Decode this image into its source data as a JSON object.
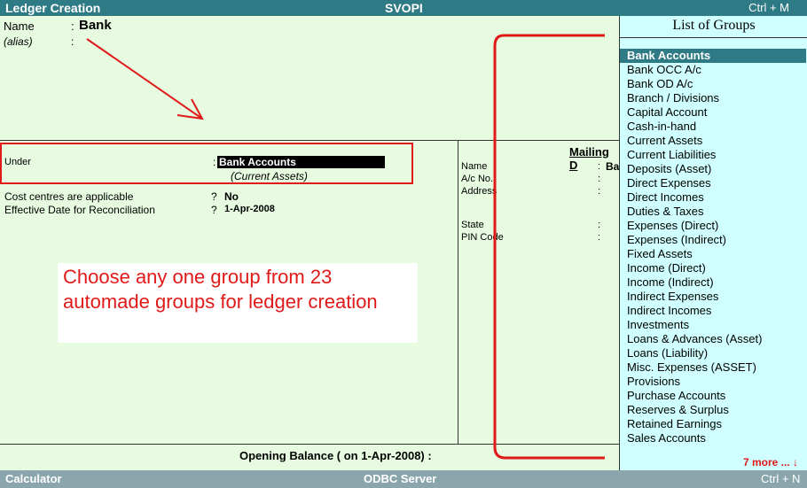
{
  "title_bar": {
    "left": "Ledger Creation",
    "center": "SVOPI",
    "shortcut": "Ctrl + M"
  },
  "form": {
    "name_label": "Name",
    "colon": ":",
    "name_value": "Bank",
    "alias_label": "(alias)",
    "under_label": "Under",
    "under_value": "Bank Accounts",
    "under_sub": "(Current Assets)",
    "cost_centres_label": "Cost centres are applicable",
    "cost_centres_q": "?",
    "cost_centres_value": "No",
    "effective_date_label": "Effective Date for Reconciliation",
    "effective_date_q": "?",
    "effective_date_value": "1-Apr-2008"
  },
  "annotation": {
    "text": "Choose any one group from 23 automade groups for ledger creation"
  },
  "mailing": {
    "title": "Mailing D",
    "fields": [
      "Name",
      "A/c No.",
      "Address",
      "State",
      "PIN Code"
    ],
    "name_value": "Ba"
  },
  "opening_balance": "Opening Balance  ( on 1-Apr-2008) :",
  "status_bar": {
    "left": "Calculator",
    "center": "ODBC Server",
    "shortcut": "Ctrl + N"
  },
  "list_of_groups": {
    "title": "List of Groups",
    "items": [
      "Bank Accounts",
      "Bank OCC A/c",
      "Bank OD A/c",
      "Branch / Divisions",
      "Capital Account",
      "Cash-in-hand",
      "Current Assets",
      "Current Liabilities",
      "Deposits (Asset)",
      "Direct Expenses",
      "Direct Incomes",
      "Duties & Taxes",
      "Expenses (Direct)",
      "Expenses (Indirect)",
      "Fixed Assets",
      "Income (Direct)",
      "Income (Indirect)",
      "Indirect Expenses",
      "Indirect Incomes",
      "Investments",
      "Loans & Advances (Asset)",
      "Loans (Liability)",
      "Misc. Expenses (ASSET)",
      "Provisions",
      "Purchase Accounts",
      "Reserves & Surplus",
      "Retained Earnings",
      "Sales Accounts"
    ],
    "selected_index": 0,
    "more": "7 more ... ↓"
  },
  "colors": {
    "title_bar": "#2e7a85",
    "form_bg": "#e6fbe0",
    "list_bg": "#cfffff",
    "annotation_red": "#e01919"
  }
}
